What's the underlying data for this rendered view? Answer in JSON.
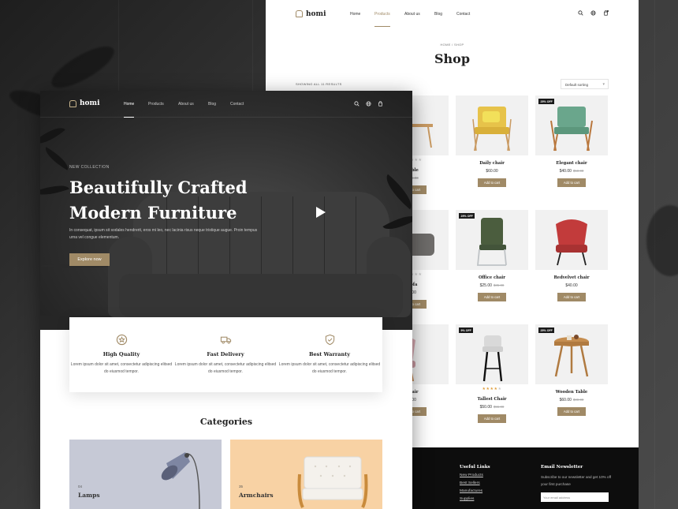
{
  "shop": {
    "logo": "homi",
    "nav": [
      {
        "label": "Home"
      },
      {
        "label": "Products"
      },
      {
        "label": "About us"
      },
      {
        "label": "Blog"
      },
      {
        "label": "Contact"
      }
    ],
    "active_nav": "Products",
    "breadcrumb": {
      "home": "HOME",
      "sep": "/",
      "current": "SHOP"
    },
    "title": "Shop",
    "result_count": "SHOWING ALL 11 RESULTS",
    "sort": {
      "value": "Default sorting"
    },
    "products": [
      {
        "name": "Table",
        "price": "",
        "old_price": "$25.00",
        "stars": 2,
        "button": "Add to cart",
        "badge": ""
      },
      {
        "name": "Daily chair",
        "price": "$60.00",
        "old_price": "",
        "stars": 0,
        "button": "Add to cart",
        "badge": ""
      },
      {
        "name": "Elegant chair",
        "price": "$40.00",
        "old_price": "$50.00",
        "stars": 0,
        "button": "Add to cart",
        "badge": "25% OFF"
      },
      {
        "name": "Sofa",
        "price": "0.00",
        "old_price": "",
        "stars": 2,
        "button": "Add to cart",
        "badge": ""
      },
      {
        "name": "Office chair",
        "price": "$25.00",
        "old_price": "$35.00",
        "stars": 0,
        "button": "Add to cart",
        "badge": "29% OFF"
      },
      {
        "name": "Redvelvet chair",
        "price": "$40.00",
        "old_price": "",
        "stars": 0,
        "button": "Add to cart",
        "badge": ""
      },
      {
        "name": "chair",
        "price": "0.00",
        "old_price": "",
        "stars": 0,
        "button": "Add to cart",
        "badge": ""
      },
      {
        "name": "Tallest Chair",
        "price": "$50.00",
        "old_price": "$55.00",
        "stars": 4,
        "button": "Add to cart",
        "badge": "9% OFF"
      },
      {
        "name": "Wooden Table",
        "price": "$60.00",
        "old_price": "$80.00",
        "stars": 0,
        "button": "Add to cart",
        "badge": "25% OFF"
      }
    ],
    "footer": {
      "useful_links_title": "Useful Links",
      "links": [
        "New Products",
        "Best Sellers",
        "Manufactures",
        "Supplies"
      ],
      "newsletter_title": "Email Newsletter",
      "newsletter_text": "Subscribe to our newsletter and get 10% off your first purchase",
      "email_placeholder": "Your email address"
    }
  },
  "home": {
    "logo": "homi",
    "nav": [
      {
        "label": "Home"
      },
      {
        "label": "Products"
      },
      {
        "label": "About us"
      },
      {
        "label": "Blog"
      },
      {
        "label": "Contact"
      }
    ],
    "active_nav": "Home",
    "hero": {
      "eyebrow": "NEW COLLECTION",
      "title_line1": "Beautifully Crafted",
      "title_line2": "Modern Furniture",
      "text": "In consequat, ipsum sit sodales hendrerit, eros mi leo, nec lacinia risus neque tristique augue. Proin tempus urna vel congue elementum.",
      "button": "Explore now"
    },
    "features": [
      {
        "icon": "medal-icon",
        "title": "High Quality",
        "text": "Lorem ipsum dolor sit amet, consectetur adipiscing elitsed do eiusmod tempor."
      },
      {
        "icon": "truck-icon",
        "title": "Fast Delivery",
        "text": "Lorem ipsum dolor sit amet, consectetur adipiscing elitsed do eiusmod tempor."
      },
      {
        "icon": "shield-check-icon",
        "title": "Best Warranty",
        "text": "Lorem ipsum dolor sit amet, consectetur adipiscing elitsed do eiusmod tempor."
      }
    ],
    "categories_title": "Categories",
    "categories": [
      {
        "count": "04",
        "name": "Lamps"
      },
      {
        "count": "35",
        "name": "Armchairs"
      }
    ]
  },
  "colors": {
    "accent": "#a08a66",
    "footer_bg": "#0d0d0d",
    "star": "#e0a040",
    "lamps_bg": "#c6c9d6",
    "armchairs_bg": "#f8d2a4"
  }
}
